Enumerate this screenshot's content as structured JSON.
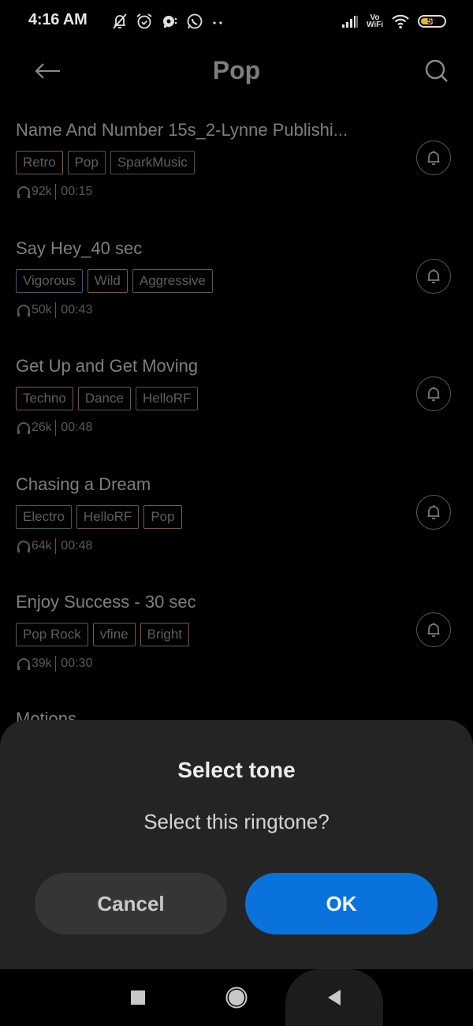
{
  "status_bar": {
    "time": "4:16 AM",
    "left_icons": [
      "notifications-muted-icon",
      "alarm-icon",
      "chat-bubble-icon",
      "whatsapp-icon",
      "more-dots-icon"
    ],
    "right_icons": [
      "signal-icon",
      "vowifi-icon",
      "wifi-icon",
      "battery-icon"
    ],
    "vowifi_top": "Vo",
    "vowifi_bottom": "WiFi",
    "battery_level": "56",
    "battery_percent": 56
  },
  "header": {
    "title": "Pop",
    "back_icon": "arrow-left-icon",
    "search_icon": "search-icon"
  },
  "ringtones": [
    {
      "title": "Name And Number 15s_2-Lynne Publishi...",
      "tags": [
        {
          "label": "Retro",
          "color": "#7a5a44"
        },
        {
          "label": "Pop",
          "color": "#4d5866"
        },
        {
          "label": "SparkMusic",
          "color": "#4a5756"
        }
      ],
      "plays": "92k",
      "duration": "00:15"
    },
    {
      "title": "Say Hey_40 sec",
      "tags": [
        {
          "label": "Vigorous",
          "color": "#4a5670"
        },
        {
          "label": "Wild",
          "color": "#7a5a44"
        },
        {
          "label": "Aggressive",
          "color": "#5a5a5a"
        }
      ],
      "plays": "50k",
      "duration": "00:43"
    },
    {
      "title": "Get Up and Get Moving",
      "tags": [
        {
          "label": "Techno",
          "color": "#7a5a44"
        },
        {
          "label": "Dance",
          "color": "#6e5450"
        },
        {
          "label": "HelloRF",
          "color": "#455a5a"
        }
      ],
      "plays": "26k",
      "duration": "00:48"
    },
    {
      "title": "Chasing a Dream",
      "tags": [
        {
          "label": "Electro",
          "color": "#435a58"
        },
        {
          "label": "HelloRF",
          "color": "#6a5250"
        },
        {
          "label": "Pop",
          "color": "#7a5a44"
        }
      ],
      "plays": "64k",
      "duration": "00:48"
    },
    {
      "title": "Enjoy Success - 30 sec",
      "tags": [
        {
          "label": "Pop Rock",
          "color": "#5a5a5a"
        },
        {
          "label": "vfine",
          "color": "#7a5a44"
        },
        {
          "label": "Bright",
          "color": "#7a5a44"
        }
      ],
      "plays": "39k",
      "duration": "00:30"
    }
  ],
  "partial_item_title": "Motions",
  "dialog": {
    "title": "Select tone",
    "message": "Select this ringtone?",
    "cancel_label": "Cancel",
    "ok_label": "OK",
    "ok_color": "#0a72dc"
  },
  "nav_bar": {
    "recents_icon": "square-icon",
    "home_icon": "circle-icon",
    "back_icon": "triangle-back-icon"
  }
}
